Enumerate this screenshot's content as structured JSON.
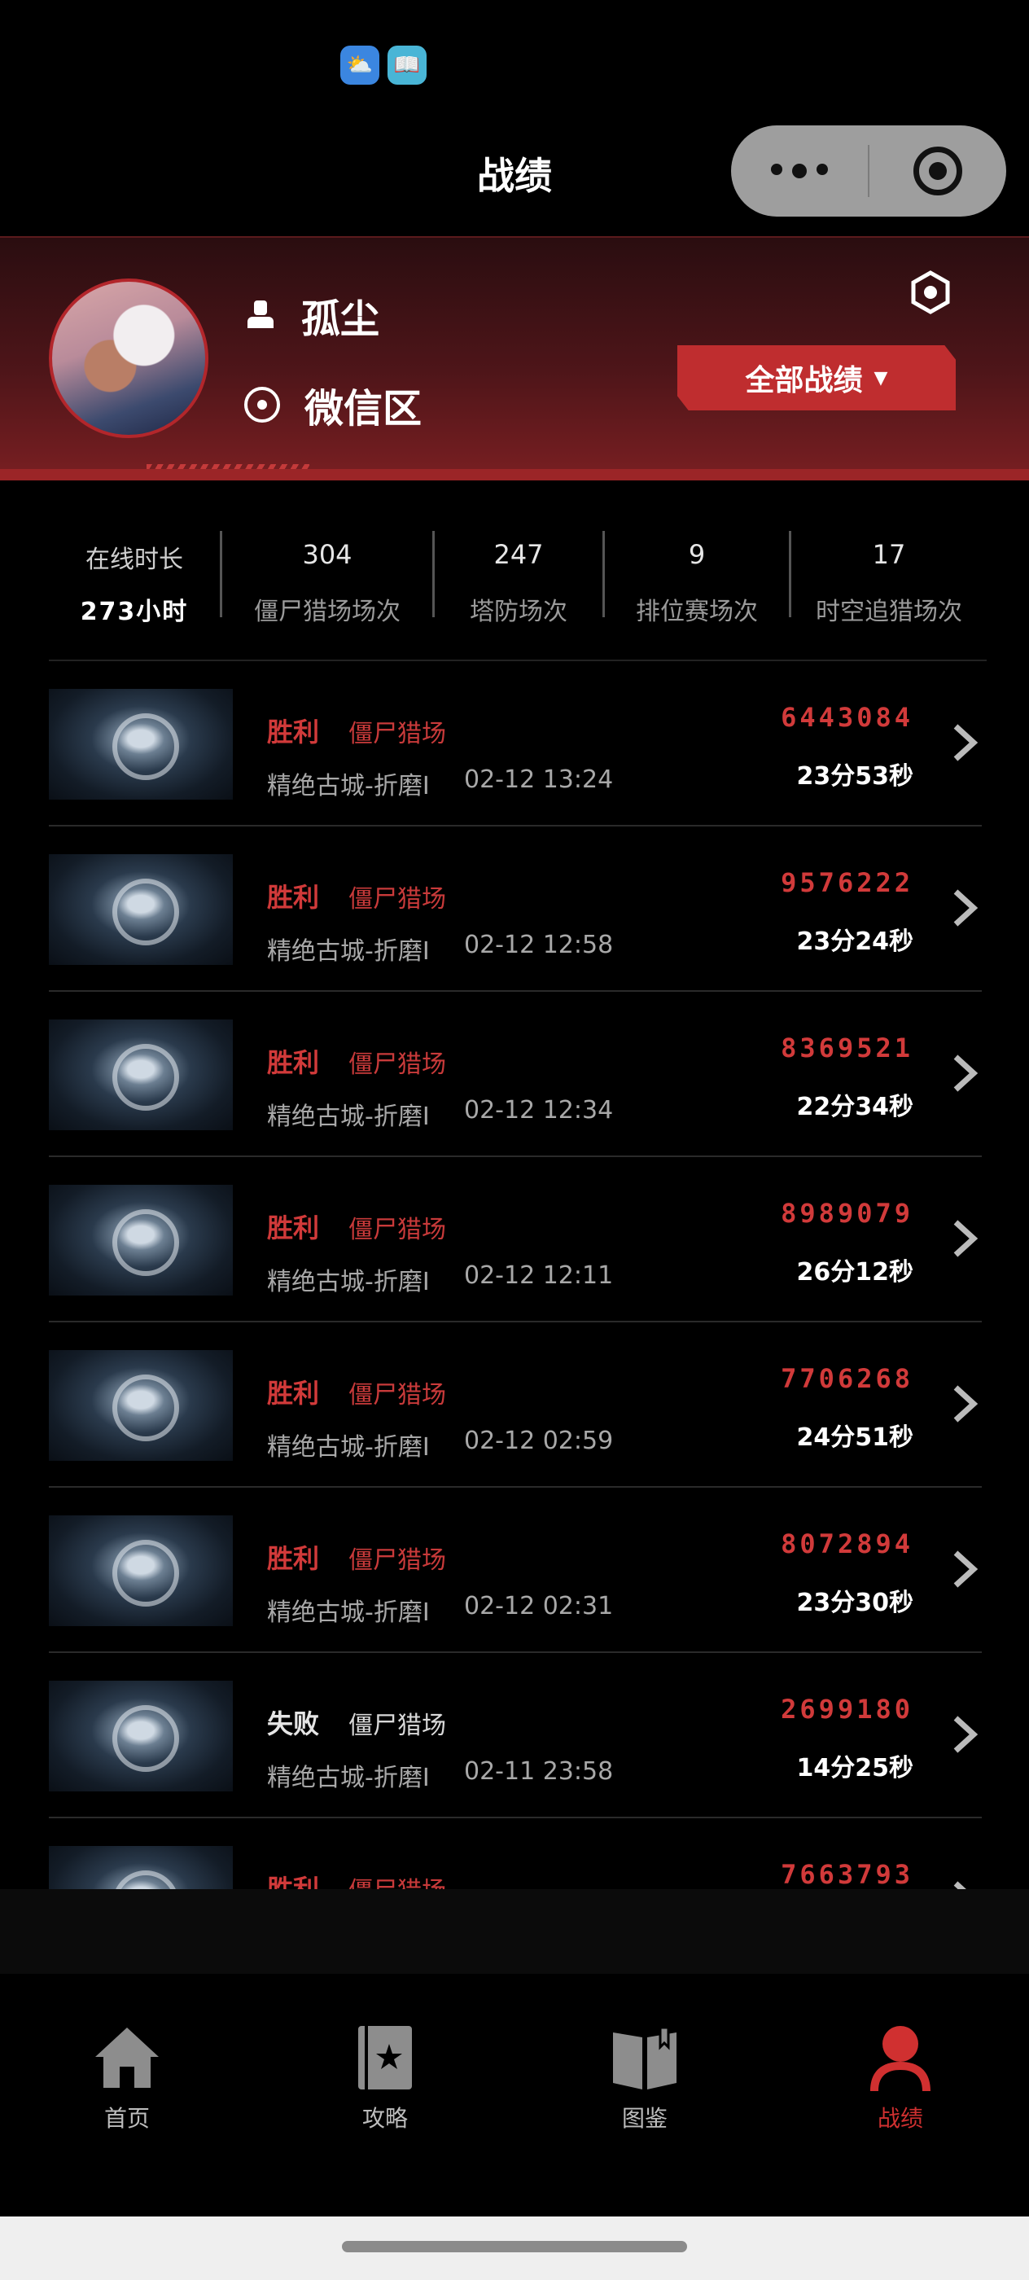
{
  "app": {
    "title": "战绩"
  },
  "mini_icons": [
    "weather-icon",
    "book-icon"
  ],
  "profile": {
    "name": "孤尘",
    "zone": "微信区",
    "filter_button": "全部战绩",
    "filter_caret": "▼"
  },
  "stats": [
    {
      "label": "在线时长",
      "value": "273小时"
    },
    {
      "label": "僵尸猎场场次",
      "value": "304"
    },
    {
      "label": "塔防场次",
      "value": "247"
    },
    {
      "label": "排位赛场次",
      "value": "9"
    },
    {
      "label": "时空追猎场次",
      "value": "17"
    }
  ],
  "records": [
    {
      "result": "胜利",
      "mode": "僵尸猎场",
      "map": "精绝古城-折磨I",
      "time": "02-12 13:24",
      "score": "6443084",
      "duration": "23分53秒",
      "win": true
    },
    {
      "result": "胜利",
      "mode": "僵尸猎场",
      "map": "精绝古城-折磨I",
      "time": "02-12 12:58",
      "score": "9576222",
      "duration": "23分24秒",
      "win": true
    },
    {
      "result": "胜利",
      "mode": "僵尸猎场",
      "map": "精绝古城-折磨I",
      "time": "02-12 12:34",
      "score": "8369521",
      "duration": "22分34秒",
      "win": true
    },
    {
      "result": "胜利",
      "mode": "僵尸猎场",
      "map": "精绝古城-折磨I",
      "time": "02-12 12:11",
      "score": "8989079",
      "duration": "26分12秒",
      "win": true
    },
    {
      "result": "胜利",
      "mode": "僵尸猎场",
      "map": "精绝古城-折磨I",
      "time": "02-12 02:59",
      "score": "7706268",
      "duration": "24分51秒",
      "win": true
    },
    {
      "result": "胜利",
      "mode": "僵尸猎场",
      "map": "精绝古城-折磨I",
      "time": "02-12 02:31",
      "score": "8072894",
      "duration": "23分30秒",
      "win": true
    },
    {
      "result": "失败",
      "mode": "僵尸猎场",
      "map": "精绝古城-折磨I",
      "time": "02-11 23:58",
      "score": "2699180",
      "duration": "14分25秒",
      "win": false
    },
    {
      "result": "胜利",
      "mode": "僵尸猎场",
      "map": "",
      "time": "",
      "score": "7663793",
      "duration": "",
      "win": true
    }
  ],
  "tabs": [
    {
      "label": "首页",
      "icon": "home-icon"
    },
    {
      "label": "攻略",
      "icon": "guide-book-icon"
    },
    {
      "label": "图鉴",
      "icon": "open-book-icon"
    },
    {
      "label": "战绩",
      "icon": "profile-icon",
      "active": true
    }
  ],
  "colors": {
    "accent": "#d13a3a",
    "button": "#bf2d2f",
    "background": "#0b0b0b"
  }
}
